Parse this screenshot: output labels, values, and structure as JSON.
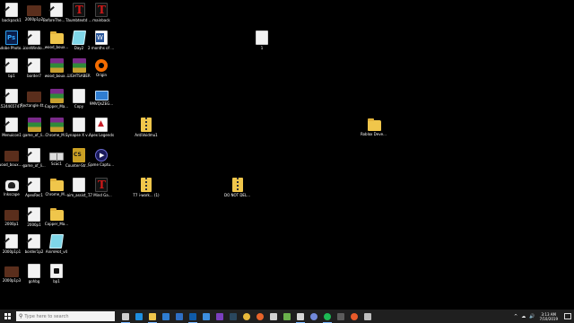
{
  "desktop_icons": [
    {
      "label": "backpack1",
      "type": "doc-pencil",
      "col": 0,
      "row": 0
    },
    {
      "label": "2000p1p2",
      "type": "brown",
      "col": 1,
      "row": 0
    },
    {
      "label": "BeforeThe... - Copy",
      "type": "doc-pencil",
      "col": 2,
      "row": 0
    },
    {
      "label": "Thumbtextd LOGO",
      "type": "tesla",
      "col": 3,
      "row": 0
    },
    {
      "label": "mainback",
      "type": "tesla",
      "col": 4,
      "row": 0
    },
    {
      "label": "Adobe Photosh...",
      "type": "ps",
      "col": 0,
      "row": 1
    },
    {
      "label": "iconWindo...",
      "type": "doc-pencil",
      "col": 1,
      "row": 1
    },
    {
      "label": "wood_boux...",
      "type": "folder",
      "col": 2,
      "row": 1
    },
    {
      "label": "Day2",
      "type": "cyan",
      "col": 3,
      "row": 1
    },
    {
      "label": "2 months of work ! a d...",
      "type": "word",
      "col": 4,
      "row": 1
    },
    {
      "label": "bp1",
      "type": "doc-pencil",
      "col": 0,
      "row": 2
    },
    {
      "label": "border7",
      "type": "doc-pencil",
      "col": 1,
      "row": 2
    },
    {
      "label": "wood_boux...",
      "type": "archive",
      "col": 2,
      "row": 2
    },
    {
      "label": "LIGHTSABER",
      "type": "archive",
      "col": 3,
      "row": 2
    },
    {
      "label": "Origin",
      "type": "origin",
      "col": 4,
      "row": 2
    },
    {
      "label": "1524465747...",
      "type": "doc-pencil",
      "col": 0,
      "row": 3
    },
    {
      "label": "Rectangle 4tdy2k Icon",
      "type": "brown",
      "col": 1,
      "row": 3
    },
    {
      "label": "Copper_Ma...",
      "type": "archive",
      "col": 2,
      "row": 3
    },
    {
      "label": "Copy",
      "type": "doc",
      "col": 3,
      "row": 3
    },
    {
      "label": "9MVQsZEG...",
      "type": "monitor",
      "col": 4,
      "row": 3
    },
    {
      "label": "Menuicon1",
      "type": "doc-pencil",
      "col": 0,
      "row": 4
    },
    {
      "label": "game_of_li...",
      "type": "archive",
      "col": 1,
      "row": 4
    },
    {
      "label": "Chrome_M...",
      "type": "archive",
      "col": 2,
      "row": 4
    },
    {
      "label": "Synapse X v1.0.0",
      "type": "doc",
      "col": 3,
      "row": 4
    },
    {
      "label": "Apex Legends",
      "type": "apex",
      "col": 4,
      "row": 4
    },
    {
      "label": "wood_boux... (1)",
      "type": "brown",
      "col": 0,
      "row": 5
    },
    {
      "label": "game_of_li...",
      "type": "doc-pencil",
      "col": 1,
      "row": 5
    },
    {
      "label": "Scac1",
      "type": "screens",
      "col": 2,
      "row": 5
    },
    {
      "label": "Counter-Str... Global Offe...",
      "type": "csgo",
      "col": 3,
      "row": 5
    },
    {
      "label": "Game Capture HD",
      "type": "game",
      "col": 4,
      "row": 5
    },
    {
      "label": "Inkscape",
      "type": "inkscape",
      "col": 0,
      "row": 6
    },
    {
      "label": "ApexRec1",
      "type": "doc-pencil",
      "col": 1,
      "row": 6
    },
    {
      "label": "Chrome_M...",
      "type": "folder",
      "col": 2,
      "row": 6
    },
    {
      "label": "aim_assist_...",
      "type": "doc",
      "col": 3,
      "row": 6
    },
    {
      "label": "T7 Mind Game...",
      "type": "tesla",
      "col": 4,
      "row": 6
    },
    {
      "label": "2000p1",
      "type": "brown",
      "col": 0,
      "row": 7
    },
    {
      "label": "2000p1",
      "type": "doc-pencil",
      "col": 1,
      "row": 7
    },
    {
      "label": "Copper_Ma...",
      "type": "folder",
      "col": 2,
      "row": 7
    },
    {
      "label": "2000p1p1",
      "type": "doc-pencil",
      "col": 0,
      "row": 8
    },
    {
      "label": "border1p2",
      "type": "doc-pencil",
      "col": 1,
      "row": 8
    },
    {
      "label": "AnimHot_v4",
      "type": "cyan",
      "col": 2,
      "row": 8
    },
    {
      "label": "2000p1p3",
      "type": "brown",
      "col": 0,
      "row": 9
    },
    {
      "label": "gohbg",
      "type": "doc",
      "col": 1,
      "row": 9
    },
    {
      "label": "bp1",
      "type": "doc-black",
      "col": 2,
      "row": 9
    }
  ],
  "loose_icons": [
    {
      "label": "1",
      "type": "doc"
    },
    {
      "label": "AntiVoidmu1",
      "type": "zip"
    },
    {
      "label": "Roblox Developme...",
      "type": "folder"
    },
    {
      "label": "T7 i-work... (1)",
      "type": "zip"
    },
    {
      "label": "DO NOT DELETE 1",
      "type": "zip"
    }
  ],
  "taskbar": {
    "search_placeholder": "Type here to search",
    "pinned": [
      "task-view",
      "edge",
      "folder",
      "store",
      "mail",
      "outlook",
      "photos",
      "visual-studio",
      "steam",
      "chrome",
      "firefox",
      "roblox",
      "minecraft",
      "obs",
      "discord",
      "spotify",
      "calculator",
      "media",
      "settings"
    ],
    "time": "3:13 AM",
    "date": "7/10/2019",
    "tray": [
      "^",
      "☁",
      "🔊"
    ]
  },
  "colors": {
    "desktop": "#000000",
    "taskbar": "#1f1f1f"
  }
}
